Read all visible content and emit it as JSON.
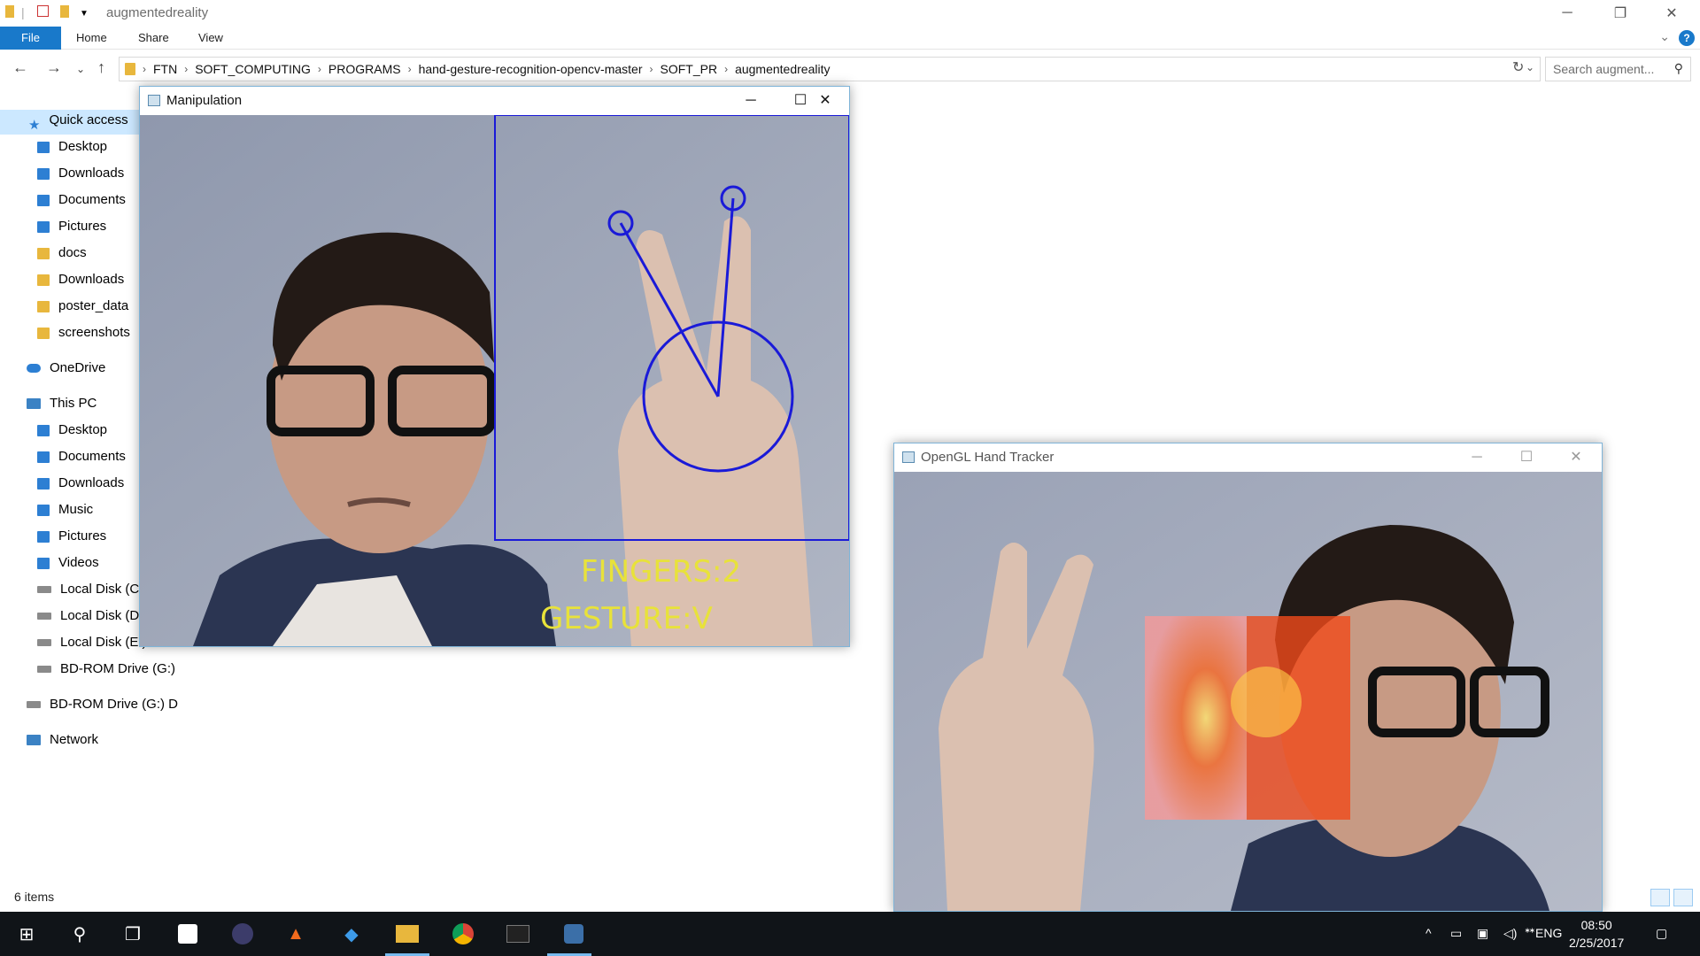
{
  "explorer": {
    "title": "augmentedreality",
    "ribbon_tabs": [
      "File",
      "Home",
      "Share",
      "View"
    ],
    "breadcrumb": [
      "FTN",
      "SOFT_COMPUTING",
      "PROGRAMS",
      "hand-gesture-recognition-opencv-master",
      "SOFT_PR",
      "augmentedreality"
    ],
    "search_placeholder": "Search augment...",
    "sidebar": {
      "quick_access": "Quick access",
      "quick_items": [
        "Desktop",
        "Downloads",
        "Documents",
        "Pictures",
        "docs",
        "Downloads",
        "poster_data",
        "screenshots"
      ],
      "onedrive": "OneDrive",
      "this_pc": "This PC",
      "pc_items": [
        "Desktop",
        "Documents",
        "Downloads",
        "Music",
        "Pictures",
        "Videos",
        "Local Disk (C:)",
        "Local Disk (D:)",
        "Local Disk (E:)",
        "BD-ROM Drive (G:)"
      ],
      "bd_drive": "BD-ROM Drive (G:) D",
      "network": "Network"
    },
    "status": "6 items"
  },
  "manipulation_window": {
    "title": "Manipulation",
    "fingers_text": "FINGERS:2",
    "gesture_text": "GESTURE:V"
  },
  "opengl_window": {
    "title": "OpenGL Hand Tracker"
  },
  "taskbar": {
    "language": "ENG",
    "time": "08:50",
    "date": "2/25/2017"
  },
  "colors": {
    "accent": "#1979ca",
    "overlay_text": "#e8e23a",
    "overlay_lines": "#1a1ad8",
    "taskbar": "#101418"
  }
}
